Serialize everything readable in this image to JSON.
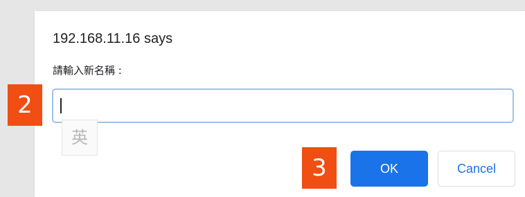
{
  "dialog": {
    "title": "192.168.11.16 says",
    "message": "請輸入新名稱 :",
    "input_value": "",
    "ok_label": "OK",
    "cancel_label": "Cancel"
  },
  "ime": {
    "mode_label": "英"
  },
  "annotations": {
    "step_2": "2",
    "step_3": "3"
  },
  "colors": {
    "accent": "#1a73e8",
    "badge": "#f04e12",
    "input_border": "#9fc1ea"
  }
}
